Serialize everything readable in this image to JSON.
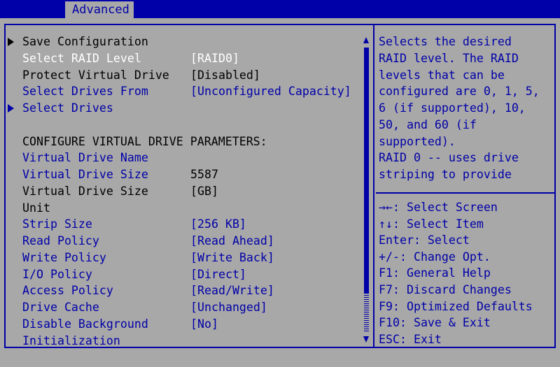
{
  "tab": {
    "label": "Advanced"
  },
  "settings": [
    {
      "label": "Save Configuration",
      "value": "",
      "submenu": true,
      "label_color": "black",
      "value_color": "black"
    },
    {
      "label": "Select RAID Level",
      "value": "[RAID0]",
      "submenu": false,
      "label_color": "white",
      "value_color": "white",
      "selected": true
    },
    {
      "label": "Protect Virtual Drive",
      "value": "[Disabled]",
      "submenu": false,
      "label_color": "black",
      "value_color": "black"
    },
    {
      "label": "Select Drives From",
      "value": "[Unconfigured Capacity]",
      "submenu": false,
      "label_color": "blue",
      "value_color": "blue"
    },
    {
      "label": "Select Drives",
      "value": "",
      "submenu": true,
      "label_color": "blue",
      "value_color": "blue"
    },
    {
      "label": "",
      "value": "",
      "submenu": false,
      "label_color": "black",
      "value_color": "black"
    },
    {
      "label": "CONFIGURE VIRTUAL DRIVE PARAMETERS:",
      "value": "",
      "submenu": false,
      "label_color": "black",
      "value_color": "black"
    },
    {
      "label": "Virtual Drive Name",
      "value": "",
      "submenu": false,
      "label_color": "blue",
      "value_color": "blue"
    },
    {
      "label": "Virtual Drive Size",
      "value": "5587",
      "submenu": false,
      "label_color": "blue",
      "value_color": "black"
    },
    {
      "label": "Virtual Drive Size",
      "value": "[GB]",
      "submenu": false,
      "label_color": "black",
      "value_color": "black"
    },
    {
      "label": "Unit",
      "value": "",
      "submenu": false,
      "label_color": "black",
      "value_color": "black"
    },
    {
      "label": "Strip Size",
      "value": "[256 KB]",
      "submenu": false,
      "label_color": "blue",
      "value_color": "blue"
    },
    {
      "label": "Read Policy",
      "value": "[Read Ahead]",
      "submenu": false,
      "label_color": "blue",
      "value_color": "blue"
    },
    {
      "label": "Write Policy",
      "value": "[Write Back]",
      "submenu": false,
      "label_color": "blue",
      "value_color": "blue"
    },
    {
      "label": "I/O Policy",
      "value": "[Direct]",
      "submenu": false,
      "label_color": "blue",
      "value_color": "blue"
    },
    {
      "label": "Access Policy",
      "value": "[Read/Write]",
      "submenu": false,
      "label_color": "blue",
      "value_color": "blue"
    },
    {
      "label": "Drive Cache",
      "value": "[Unchanged]",
      "submenu": false,
      "label_color": "blue",
      "value_color": "blue"
    },
    {
      "label": "Disable Background",
      "value": "[No]",
      "submenu": false,
      "label_color": "blue",
      "value_color": "blue"
    },
    {
      "label": "Initialization",
      "value": "",
      "submenu": false,
      "label_color": "blue",
      "value_color": "blue"
    }
  ],
  "scrollbar": {
    "position_fraction": 0.86
  },
  "help": {
    "description_lines": [
      "Selects the desired",
      "RAID level. The RAID",
      "levels that can be",
      "configured are 0, 1, 5,",
      "6 (if supported), 10,",
      "50, and 60 (if",
      "supported).",
      "RAID 0 -- uses drive",
      "striping to provide"
    ],
    "key_lines": [
      "→←: Select Screen",
      "↑↓: Select Item",
      "Enter: Select",
      "+/-: Change Opt.",
      "F1: General Help",
      "F7: Discard Changes",
      "F9: Optimized Defaults",
      "F10: Save & Exit",
      "ESC: Exit"
    ]
  },
  "colors": {
    "background": "#a8a8a8",
    "accent": "#0000a8",
    "highlight": "#ffffff"
  }
}
